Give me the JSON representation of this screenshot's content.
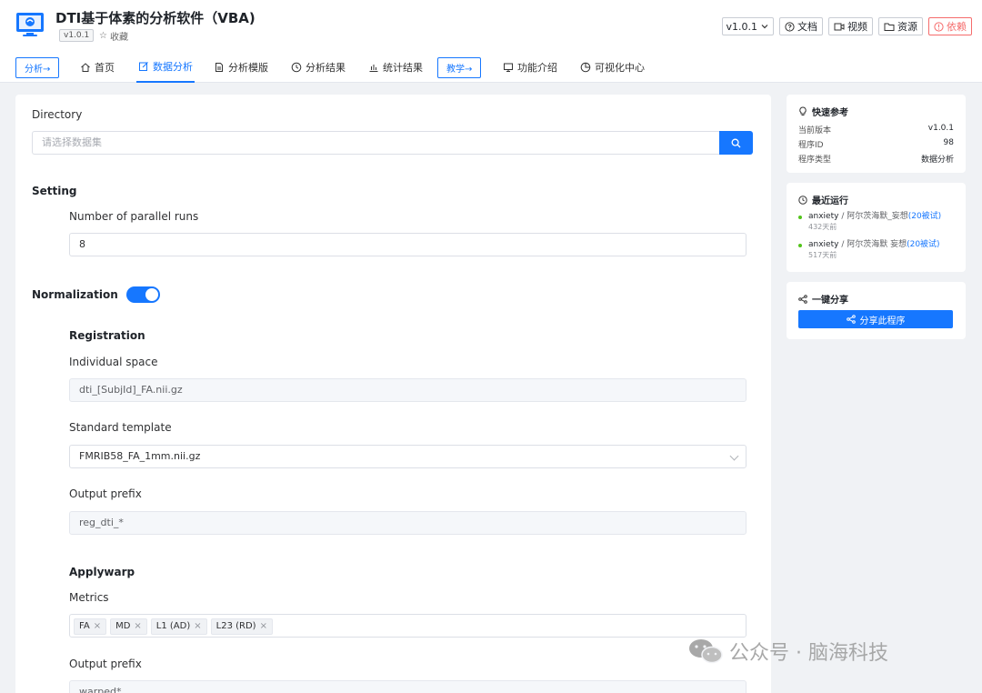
{
  "header": {
    "title": "DTI基于体素的分析软件（VBA)",
    "version_tag": "v1.0.1",
    "favorite": "收藏",
    "version_select": "v1.0.1",
    "buttons": {
      "docs": "文档",
      "video": "视频",
      "resources": "资源",
      "deps": "依赖"
    }
  },
  "nav": {
    "analyze_btn": "分析→",
    "items": [
      "首页",
      "数据分析",
      "分析模版",
      "分析结果",
      "统计结果"
    ],
    "teach_btn": "教学→",
    "items2": [
      "功能介绍",
      "可视化中心"
    ],
    "active": "数据分析"
  },
  "form": {
    "directory_label": "Directory",
    "directory_placeholder": "请选择数据集",
    "setting_title": "Setting",
    "parallel_label": "Number of parallel runs",
    "parallel_value": "8",
    "normalization_title": "Normalization",
    "normalization_enabled": true,
    "registration_title": "Registration",
    "individual_space_label": "Individual space",
    "individual_space_value": "dti_[SubjId]_FA.nii.gz",
    "standard_template_label": "Standard template",
    "standard_template_value": "FMRIB58_FA_1mm.nii.gz",
    "output_prefix_label": "Output prefix",
    "output_prefix_value": "reg_dti_*",
    "applywarp_title": "Applywarp",
    "metrics_label": "Metrics",
    "metrics": [
      "FA",
      "MD",
      "L1 (AD)",
      "L23 (RD)"
    ],
    "output_prefix2_label": "Output prefix",
    "output_prefix2_value": "warped*"
  },
  "quick_ref": {
    "title": "快速参考",
    "rows": [
      {
        "k": "当前版本",
        "v": "v1.0.1"
      },
      {
        "k": "程序ID",
        "v": "98"
      },
      {
        "k": "程序类型",
        "v": "数据分析"
      }
    ]
  },
  "recent": {
    "title": "最近运行",
    "runs": [
      {
        "name": "anxiety",
        "user": " / 阿尔茨海默_妄想",
        "count": "(20被试)",
        "time": "432天前"
      },
      {
        "name": "anxiety",
        "user": " / 阿尔茨海默 妄想",
        "count": "(20被试)",
        "time": "517天前"
      }
    ]
  },
  "share": {
    "title": "一键分享",
    "button": "分享此程序"
  },
  "watermark": "公众号 · 脑海科技",
  "colors": {
    "accent": "#1677ff",
    "danger": "#f56c6c",
    "success": "#52c41a"
  }
}
